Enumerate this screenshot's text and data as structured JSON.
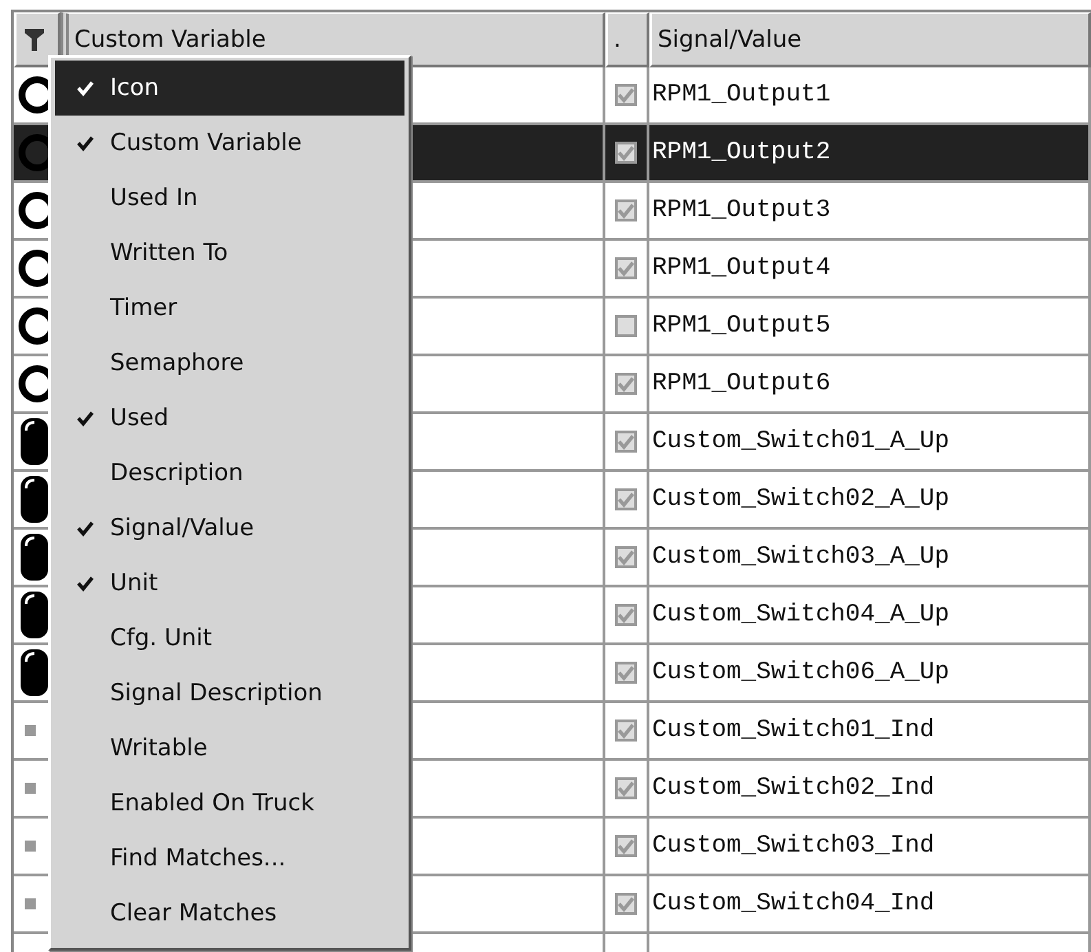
{
  "table": {
    "columns": [
      {
        "kind": "filter"
      },
      {
        "kind": "text",
        "label": "Custom Variable"
      },
      {
        "kind": "text",
        "label": "."
      },
      {
        "kind": "text",
        "label": "Signal/Value"
      }
    ],
    "rows": [
      {
        "kind": "ring",
        "selected": false,
        "used": true,
        "signal": "RPM1_Output1"
      },
      {
        "kind": "ring",
        "selected": true,
        "used": true,
        "signal": "RPM1_Output2"
      },
      {
        "kind": "ring",
        "selected": false,
        "used": true,
        "signal": "RPM1_Output3"
      },
      {
        "kind": "ring",
        "selected": false,
        "used": true,
        "signal": "RPM1_Output4"
      },
      {
        "kind": "ring",
        "selected": false,
        "used": false,
        "signal": "RPM1_Output5"
      },
      {
        "kind": "ring",
        "selected": false,
        "used": true,
        "signal": "RPM1_Output6"
      },
      {
        "kind": "pill",
        "selected": false,
        "used": true,
        "signal": "Custom_Switch01_A_Up"
      },
      {
        "kind": "pill",
        "selected": false,
        "used": true,
        "signal": "Custom_Switch02_A_Up"
      },
      {
        "kind": "pill",
        "selected": false,
        "used": true,
        "signal": "Custom_Switch03_A_Up"
      },
      {
        "kind": "pill",
        "selected": false,
        "used": true,
        "signal": "Custom_Switch04_A_Up"
      },
      {
        "kind": "pill",
        "selected": false,
        "used": true,
        "signal": "Custom_Switch06_A_Up"
      },
      {
        "kind": "square",
        "selected": false,
        "used": true,
        "signal": "Custom_Switch01_Ind"
      },
      {
        "kind": "square",
        "selected": false,
        "used": true,
        "signal": "Custom_Switch02_Ind"
      },
      {
        "kind": "square",
        "selected": false,
        "used": true,
        "signal": "Custom_Switch03_Ind"
      },
      {
        "kind": "square",
        "selected": false,
        "used": true,
        "signal": "Custom_Switch04_Ind"
      }
    ]
  },
  "context_menu": {
    "items": [
      {
        "label": "Icon",
        "checked": true,
        "selected": true
      },
      {
        "label": "Custom Variable",
        "checked": true,
        "selected": false
      },
      {
        "label": "Used In",
        "checked": false,
        "selected": false
      },
      {
        "label": "Written To",
        "checked": false,
        "selected": false
      },
      {
        "label": "Timer",
        "checked": false,
        "selected": false
      },
      {
        "label": "Semaphore",
        "checked": false,
        "selected": false
      },
      {
        "label": "Used",
        "checked": true,
        "selected": false
      },
      {
        "label": "Description",
        "checked": false,
        "selected": false
      },
      {
        "label": "Signal/Value",
        "checked": true,
        "selected": false
      },
      {
        "label": "Unit",
        "checked": true,
        "selected": false
      },
      {
        "label": "Cfg. Unit",
        "checked": false,
        "selected": false
      },
      {
        "label": "Signal Description",
        "checked": false,
        "selected": false
      },
      {
        "label": "Writable",
        "checked": false,
        "selected": false
      },
      {
        "label": "Enabled On Truck",
        "checked": false,
        "selected": false
      },
      {
        "label": "Find Matches...",
        "checked": false,
        "selected": false
      },
      {
        "label": "Clear Matches",
        "checked": false,
        "selected": false
      }
    ]
  }
}
